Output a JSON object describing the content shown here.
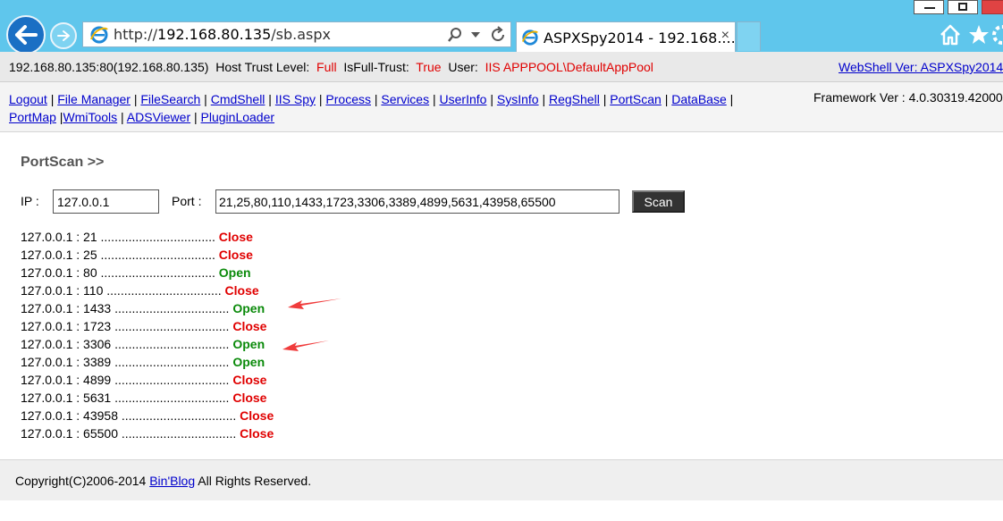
{
  "browser": {
    "address_prefix": "http://",
    "address_host": "192.168.80.135",
    "address_path": "/sb.aspx",
    "tab_title": "ASPXSpy2014 - 192.168....",
    "tab_close": "×"
  },
  "info": {
    "host": "192.168.80.135:80(192.168.80.135)",
    "trust_label": "Host Trust Level:",
    "trust_value": "Full",
    "fulltrust_label": "IsFull-Trust:",
    "fulltrust_value": "True",
    "user_label": "User:",
    "user_value": "IIS APPPOOL\\DefaultAppPool",
    "version_link": "WebShell Ver: ASPXSpy2014"
  },
  "menu": {
    "row1": [
      "Logout",
      "File Manager",
      "FileSearch",
      "CmdShell",
      "IIS Spy",
      "Process",
      "Services",
      "UserInfo",
      "SysInfo",
      "RegShell",
      "PortScan",
      "DataBase"
    ],
    "row2": [
      "PortMap",
      "WmiTools",
      "ADSViewer",
      "PluginLoader"
    ],
    "framework": "Framework Ver : 4.0.30319.42000"
  },
  "portscan": {
    "title": "PortScan >>",
    "ip_label": "IP :",
    "ip_value": "127.0.0.1",
    "port_label": "Port :",
    "port_value": "21,25,80,110,1433,1723,3306,3389,4899,5631,43958,65500",
    "scan_label": "Scan",
    "results": [
      {
        "line": "127.0.0.1 : 21 .................................",
        "status": "Close"
      },
      {
        "line": "127.0.0.1 : 25 .................................",
        "status": "Close"
      },
      {
        "line": "127.0.0.1 : 80 .................................",
        "status": "Open"
      },
      {
        "line": "127.0.0.1 : 110 .................................",
        "status": "Close"
      },
      {
        "line": "127.0.0.1 : 1433 .................................",
        "status": "Open"
      },
      {
        "line": "127.0.0.1 : 1723 .................................",
        "status": "Close"
      },
      {
        "line": "127.0.0.1 : 3306 .................................",
        "status": "Open"
      },
      {
        "line": "127.0.0.1 : 3389 .................................",
        "status": "Open"
      },
      {
        "line": "127.0.0.1 : 4899 .................................",
        "status": "Close"
      },
      {
        "line": "127.0.0.1 : 5631 .................................",
        "status": "Close"
      },
      {
        "line": "127.0.0.1 : 43958 .................................",
        "status": "Close"
      },
      {
        "line": "127.0.0.1 : 65500 .................................",
        "status": "Close"
      }
    ],
    "status_colors": {
      "Open": "#0a8a0a",
      "Close": "#e00000"
    },
    "annotation_color": "#f03c3c"
  },
  "footer": {
    "prefix": "Copyright(C)2006-2014 ",
    "link": "Bin'Blog",
    "suffix": " All Rights Reserved."
  }
}
